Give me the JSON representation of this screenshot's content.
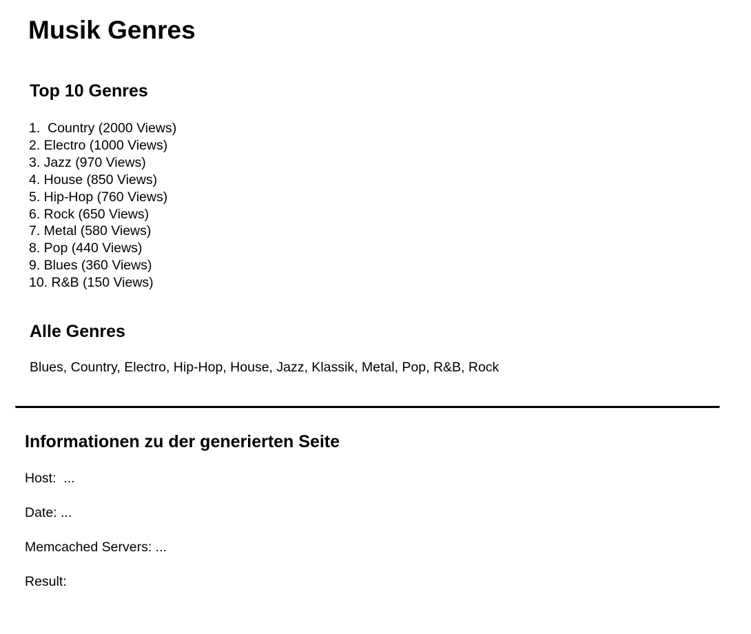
{
  "page": {
    "title": "Musik Genres"
  },
  "top_genres": {
    "heading": "Top 10 Genres",
    "items": [
      "1.  Country (2000 Views)",
      "2. Electro (1000 Views)",
      "3. Jazz (970 Views)",
      "4. House (850 Views)",
      "5. Hip-Hop (760 Views)",
      "6. Rock (650 Views)",
      "7. Metal (580 Views)",
      "8. Pop (440 Views)",
      "9. Blues (360 Views)",
      "10. R&B (150 Views)"
    ]
  },
  "all_genres": {
    "heading": "Alle Genres",
    "text": "Blues, Country, Electro, Hip-Hop, House, Jazz, Klassik, Metal, Pop, R&B, Rock"
  },
  "info": {
    "heading": "Informationen zu der generierten Seite",
    "host": "Host:  ...",
    "date": "Date: ...",
    "memcached": "Memcached Servers: ...",
    "result": "Result:"
  }
}
